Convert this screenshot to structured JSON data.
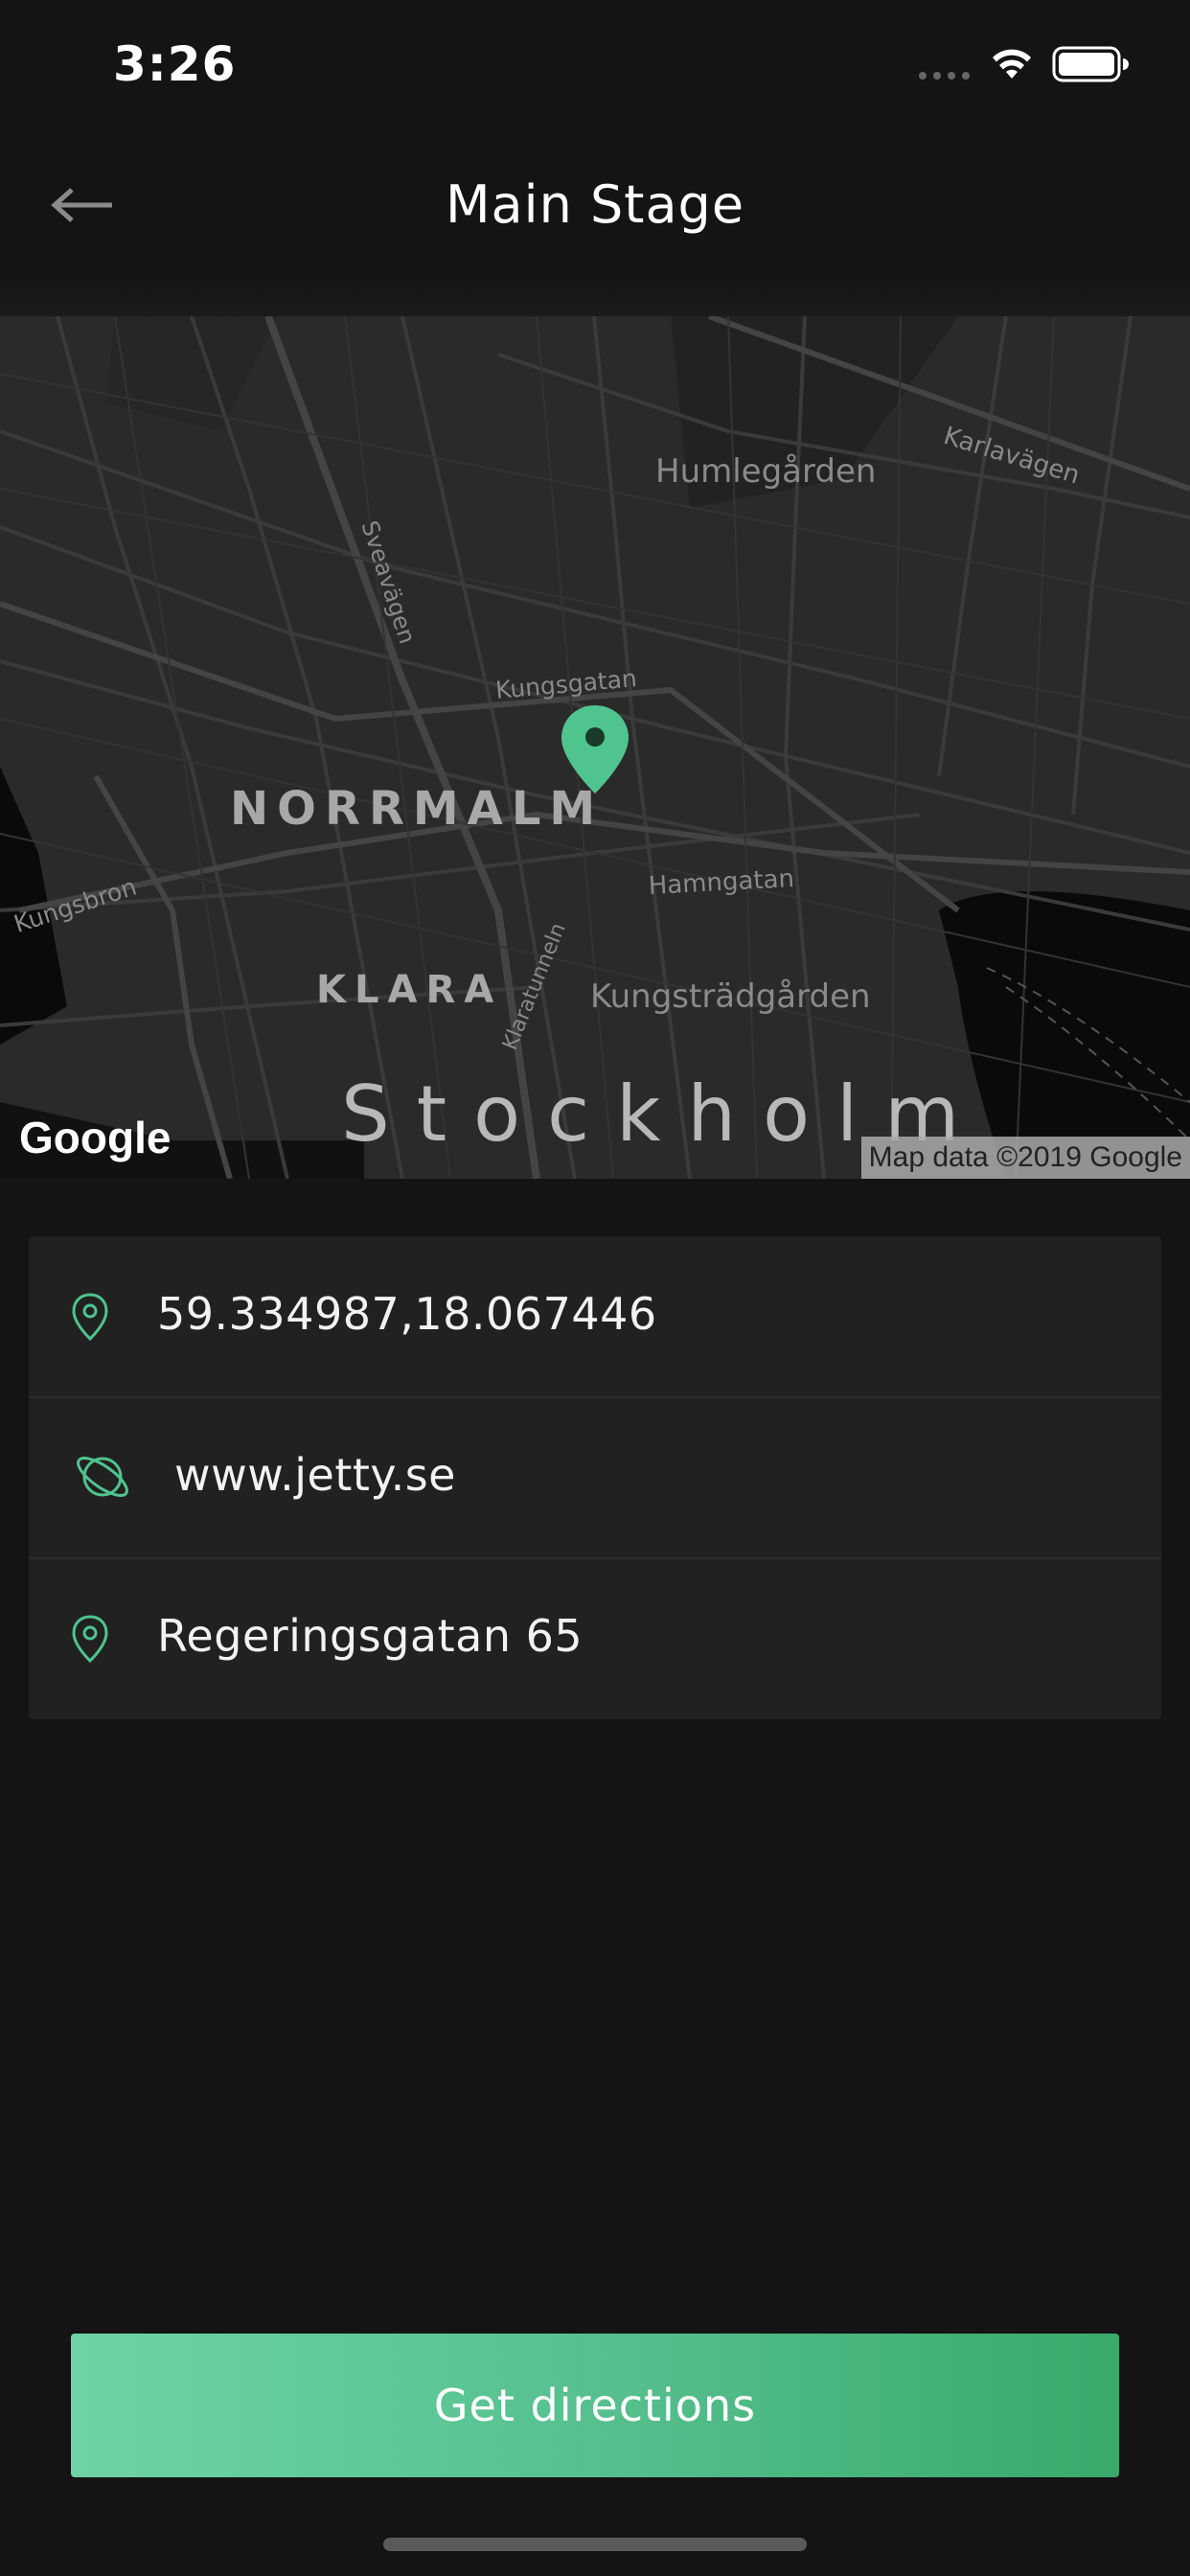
{
  "status_bar": {
    "time": "3:26"
  },
  "header": {
    "title": "Main Stage"
  },
  "map": {
    "labels": {
      "humlegarden": "Humlegården",
      "karlavagen": "Karlavägen",
      "sveavagen": "Sveavägen",
      "kungsgatan": "Kungsgatan",
      "norrmalm": "NORRMALM",
      "kungsbron": "Kungsbron",
      "hamngatan": "Hamngatan",
      "klara": "KLARA",
      "klaratunneln": "Klaratunneln",
      "kungstradgarden": "Kungsträdgården",
      "stockholm": "Stockholm"
    },
    "logo": "Google",
    "attribution": "Map data ©2019 Google"
  },
  "details": {
    "coordinates": "59.334987,18.067446",
    "website": "www.jetty.se",
    "address": "Regeringsgatan 65"
  },
  "actions": {
    "directions_label": "Get directions"
  },
  "colors": {
    "accent": "#4fc48f",
    "background": "#141414",
    "card": "#212121"
  }
}
